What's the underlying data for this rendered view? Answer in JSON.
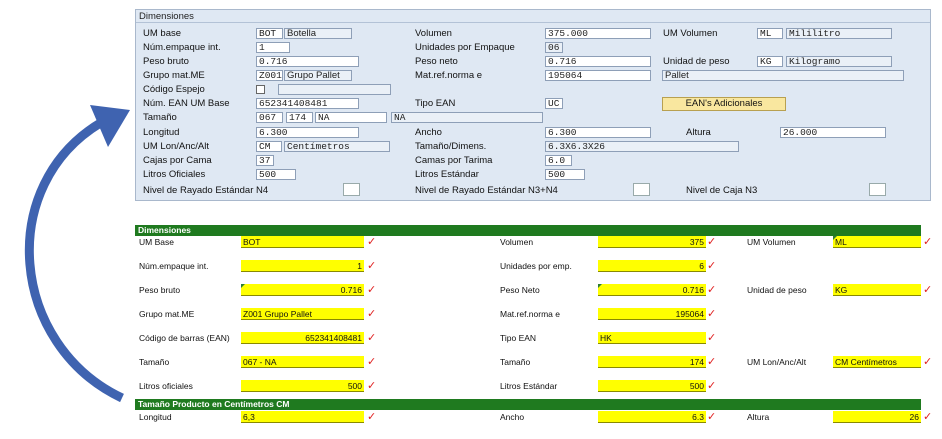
{
  "sap": {
    "title": "Dimensiones",
    "um_base": {
      "label": "UM base",
      "code": "BOT",
      "text": "Botella"
    },
    "volumen": {
      "label": "Volumen",
      "value": "375.000"
    },
    "um_volumen": {
      "label": "UM Volumen",
      "code": "ML",
      "text": "Mililitro"
    },
    "num_empaque": {
      "label": "Núm.empaque int.",
      "value": "1"
    },
    "unid_empaque": {
      "label": "Unidades por Empaque",
      "value": "06"
    },
    "peso_bruto": {
      "label": "Peso bruto",
      "value": "0.716"
    },
    "peso_neto": {
      "label": "Peso neto",
      "value": "0.716"
    },
    "unidad_peso": {
      "label": "Unidad de peso",
      "code": "KG",
      "text": "Kilogramo"
    },
    "grupo_mat": {
      "label": "Grupo mat.ME",
      "code": "Z001",
      "text": "Grupo Pallet"
    },
    "mat_ref": {
      "label": "Mat.ref.norma e",
      "value": "195064",
      "text": "Pallet"
    },
    "codigo_espejo": {
      "label": "Código Espejo"
    },
    "num_ean": {
      "label": "Núm. EAN UM Base",
      "value": "652341408481"
    },
    "tipo_ean": {
      "label": "Tipo EAN",
      "value": "UC"
    },
    "ean_button": "EAN's Adicionales",
    "tamano": {
      "label": "Tamaño",
      "v1": "067",
      "v2": "174",
      "v3": "NA",
      "v4": "NA"
    },
    "longitud": {
      "label": "Longitud",
      "value": "6.300"
    },
    "ancho": {
      "label": "Ancho",
      "value": "6.300"
    },
    "altura": {
      "label": "Altura",
      "value": "26.000"
    },
    "um_lon": {
      "label": "UM Lon/Anc/Alt",
      "code": "CM",
      "text": "Centímetros"
    },
    "tamano_dim": {
      "label": "Tamaño/Dimens.",
      "value": "6.3X6.3X26"
    },
    "cajas_cama": {
      "label": "Cajas por Cama",
      "value": "37"
    },
    "camas_tarima": {
      "label": "Camas por Tarima",
      "value": "6.0"
    },
    "litros_oficiales": {
      "label": "Litros Oficiales",
      "value": "500"
    },
    "litros_estandar": {
      "label": "Litros Estándar",
      "value": "500"
    },
    "rayado_n4": {
      "label": "Nivel de Rayado Estándar N4"
    },
    "rayado_n3n4": {
      "label": "Nivel de Rayado Estándar N3+N4"
    },
    "caja_n3": {
      "label": "Nivel de Caja N3"
    }
  },
  "xl": {
    "header1": "Dimensiones",
    "um_base": {
      "label": "UM Base",
      "value": "BOT"
    },
    "volumen": {
      "label": "Volumen",
      "value": "375"
    },
    "um_volumen": {
      "label": "UM Volumen",
      "value": "ML"
    },
    "num_empaque": {
      "label": "Núm.empaque int.",
      "value": "1"
    },
    "unid_emp": {
      "label": "Unidades por emp.",
      "value": "6"
    },
    "peso_bruto": {
      "label": "Peso bruto",
      "value": "0.716"
    },
    "peso_neto": {
      "label": "Peso Neto",
      "value": "0.716"
    },
    "unidad_peso": {
      "label": "Unidad de peso",
      "value": "KG"
    },
    "grupo_mat": {
      "label": "Grupo mat.ME",
      "value": "Z001 Grupo Pallet"
    },
    "mat_ref": {
      "label": "Mat.ref.norma e",
      "value": "195064"
    },
    "codigo_barras": {
      "label": "Código de barras (EAN)",
      "value": "652341408481"
    },
    "tipo_ean": {
      "label": "Tipo EAN",
      "value": "HK"
    },
    "tamano1": {
      "label": "Tamaño",
      "value": "067 - NA"
    },
    "tamano2": {
      "label": "Tamaño",
      "value": "174"
    },
    "um_lon": {
      "label": "UM Lon/Anc/Alt",
      "value": "CM Centímetros"
    },
    "litros_oficiales": {
      "label": "Litros oficiales",
      "value": "500"
    },
    "litros_estandar": {
      "label": "Litros Estándar",
      "value": "500"
    },
    "header2": "Tamaño Producto en Centímetros CM",
    "longitud": {
      "label": "Longitud",
      "value": "6,3"
    },
    "ancho": {
      "label": "Ancho",
      "value": "6.3"
    },
    "altura": {
      "label": "Altura",
      "value": "26"
    },
    "check": "✓"
  },
  "colors": {
    "arrow": "#3f63b0",
    "header_green": "#1f7a1f",
    "highlight": "#ffff00",
    "check": "#e02020",
    "sap_bg": "#dfe8f3"
  }
}
